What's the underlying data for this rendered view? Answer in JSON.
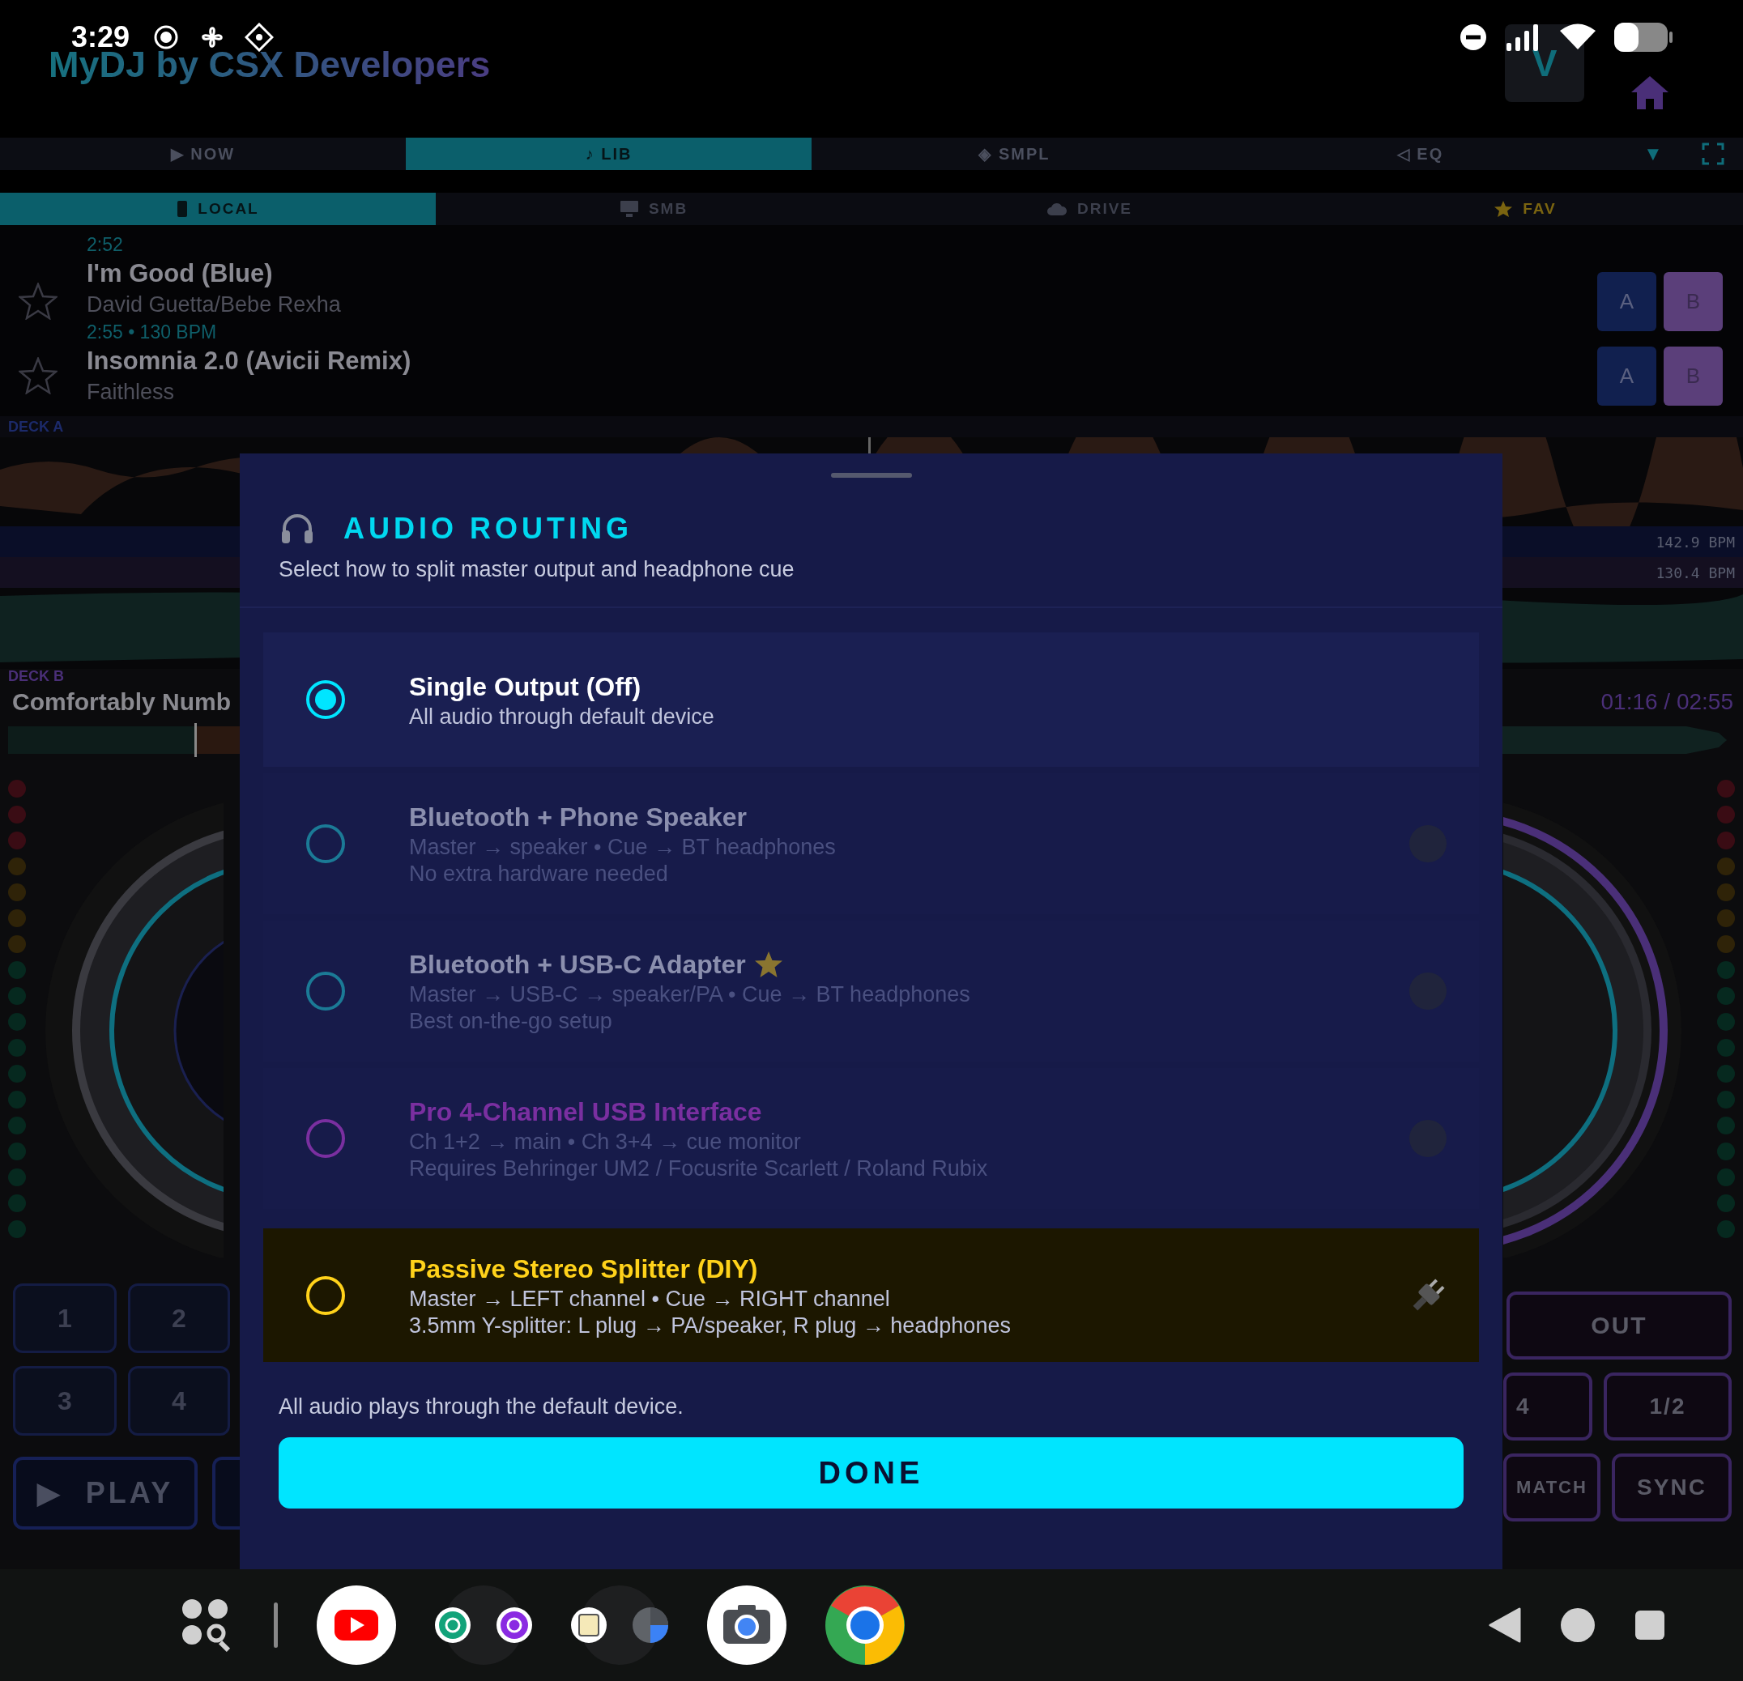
{
  "status_bar": {
    "time": "3:29"
  },
  "app_bar": {
    "title": "MyDJ by CSX Developers",
    "mode_button": "V"
  },
  "tabs": [
    {
      "icon": "▶",
      "label": "NOW",
      "selected": false
    },
    {
      "icon": "♪",
      "label": "LIB",
      "selected": true
    },
    {
      "icon": "◈",
      "label": "SMPL",
      "selected": false
    },
    {
      "icon": "◁",
      "label": "EQ",
      "selected": false
    }
  ],
  "tab_menu": "▼",
  "sources": [
    {
      "kind": "phone",
      "label": "LOCAL",
      "selected": true
    },
    {
      "kind": "monitor",
      "label": "SMB",
      "selected": false
    },
    {
      "kind": "cloud",
      "label": "DRIVE",
      "selected": false
    },
    {
      "kind": "star",
      "label": "FAV",
      "selected": false
    }
  ],
  "tracks": [
    {
      "meta": "2:52"
    },
    {
      "title": "I'm Good (Blue)",
      "artist": "David Guetta/Bebe Rexha",
      "meta": "2:55 • 130 BPM",
      "starred": false,
      "deck_buttons": [
        "A",
        "B"
      ]
    },
    {
      "title": "Insomnia 2.0 (Avicii Remix)",
      "artist": "Faithless",
      "starred": false,
      "deck_buttons": [
        "A",
        "B"
      ]
    }
  ],
  "deck_a": {
    "label": "DECK A",
    "bpm": "142.9 BPM",
    "mirrored_bpm": "130.4 BPM"
  },
  "deck_b": {
    "label": "DECK B",
    "title": "Comfortably Numb",
    "time": "01:16 / 02:55"
  },
  "hot_cues": [
    "1",
    "2",
    "3",
    "4"
  ],
  "play": {
    "icon": "▶",
    "label": "PLAY"
  },
  "loop_controls": {
    "out": "OUT",
    "quarter": "4",
    "half": "1/2",
    "match": "MATCH",
    "sync": "SYNC"
  },
  "dialog": {
    "title": "AUDIO ROUTING",
    "subtitle": "Select how to split master output and headphone cue",
    "options": [
      {
        "title": "Single Output (Off)",
        "lines": [
          "All audio through default device"
        ],
        "selected": true,
        "dimmed": false,
        "highlighted": false,
        "featured": false,
        "kind": "plain",
        "color": "#00e5ff",
        "accent_title": false
      },
      {
        "title": "Bluetooth + Phone Speaker",
        "lines": [
          "Master → speaker • Cue → BT headphones",
          "No extra hardware needed"
        ],
        "selected": false,
        "dimmed": true,
        "highlighted": false,
        "featured": false,
        "kind": "dot",
        "color": "#1b7a96",
        "accent_title": false
      },
      {
        "title": "Bluetooth + USB-C Adapter",
        "lines": [
          "Master → USB-C → speaker/PA • Cue → BT headphones",
          "Best on-the-go setup"
        ],
        "selected": false,
        "dimmed": true,
        "highlighted": false,
        "featured": true,
        "kind": "dot",
        "color": "#1b7a96",
        "accent_title": false
      },
      {
        "title": "Pro 4-Channel USB Interface",
        "lines": [
          "Ch 1+2 → main • Ch 3+4 → cue monitor",
          "Requires Behringer UM2 / Focusrite Scarlett / Roland Rubix"
        ],
        "selected": false,
        "dimmed": true,
        "highlighted": false,
        "featured": false,
        "kind": "dot",
        "color": "#7a2fa0",
        "accent_title": true
      },
      {
        "title": "Passive Stereo Splitter (DIY)",
        "lines": [
          "Master → LEFT channel • Cue → RIGHT channel",
          "3.5mm Y-splitter: L plug → PA/speaker, R plug → headphones"
        ],
        "selected": false,
        "dimmed": false,
        "highlighted": true,
        "featured": false,
        "kind": "plug",
        "color": "#ffd21a",
        "accent_title": true
      }
    ],
    "note": "All audio plays through the default device.",
    "done": "DONE"
  }
}
